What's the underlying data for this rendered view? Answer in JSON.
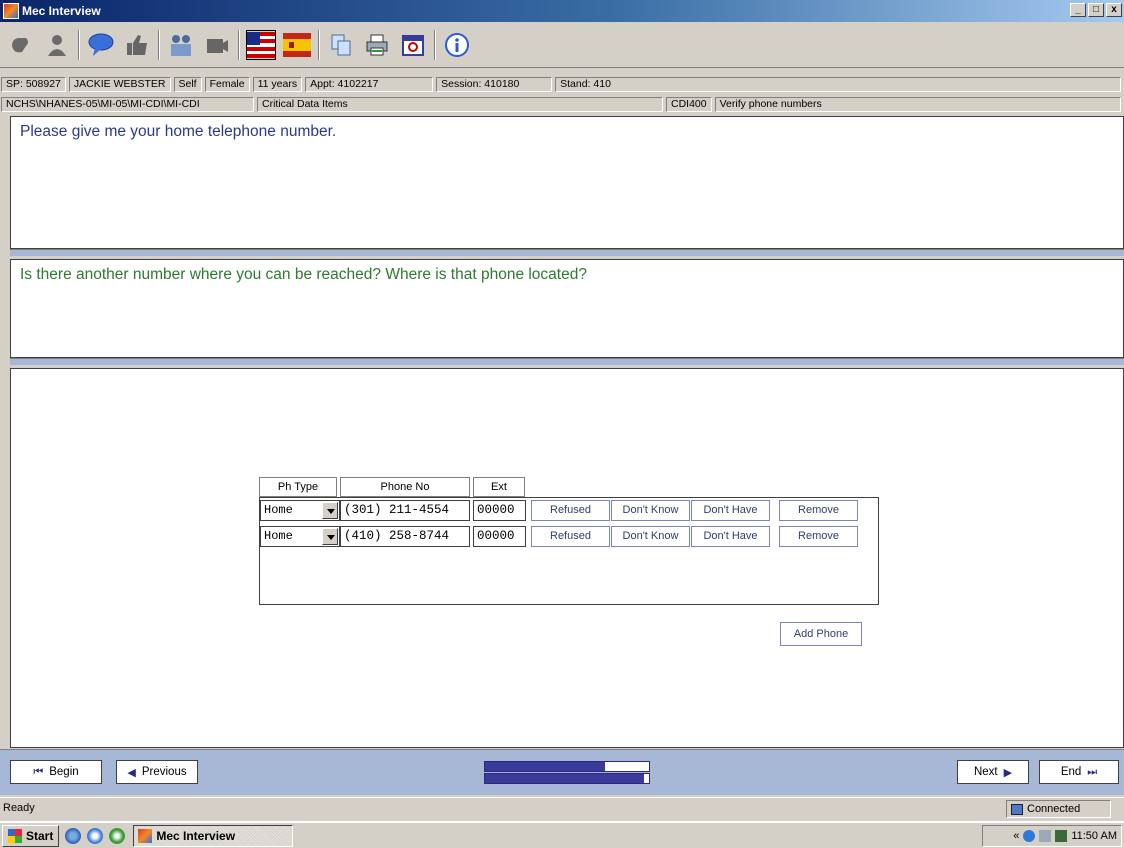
{
  "window": {
    "title": "Mec Interview",
    "controls": [
      "_",
      "□",
      "x"
    ]
  },
  "toolbar": {
    "icons": [
      "puzzle-icon",
      "person-icon",
      "speech-bubble-icon",
      "thumbs-up-icon",
      "people-icon",
      "video-icon",
      "us-flag-icon",
      "spain-flag-icon",
      "copy-icon",
      "printer-icon",
      "calendar-icon",
      "info-icon"
    ]
  },
  "info_bar_1": {
    "sp": "SP: 508927",
    "name": "JACKIE  WEBSTER",
    "relation": "Self",
    "gender": "Female",
    "age": "11 years",
    "appt": "Appt: 4102217",
    "session": "Session: 410180",
    "stand": "Stand: 410"
  },
  "info_bar_2": {
    "path": "NCHS\\NHANES-05\\MI-05\\MI-CDI\\MI-CDI",
    "section": "Critical Data Items",
    "code": "CDI400",
    "description": "Verify phone numbers"
  },
  "question_1": "Please give me your home telephone number.",
  "question_2": "Is there another number where you can be reached? Where is that phone located?",
  "phone_table": {
    "headers": {
      "type": "Ph Type",
      "number": "Phone No",
      "ext": "Ext"
    },
    "rows": [
      {
        "type": "Home",
        "number": "(301) 211-4554",
        "ext": "00000"
      },
      {
        "type": "Home",
        "number": "(410) 258-8744",
        "ext": "00000"
      }
    ],
    "row_buttons": {
      "refused": "Refused",
      "dont_know": "Don't Know",
      "dont_have": "Don't Have",
      "remove": "Remove"
    },
    "add_button": "Add Phone"
  },
  "navigation": {
    "begin": "Begin",
    "previous": "Previous",
    "next": "Next",
    "end": "End",
    "progress_top": 0.73,
    "progress_bottom": 0.97
  },
  "status": {
    "left": "Ready",
    "right": "Connected"
  },
  "taskbar": {
    "start": "start",
    "task": "Mec Interview",
    "time": "11:50 AM"
  },
  "colors": {
    "question_1": "#2a3a8a",
    "question_2": "#2e7a2e",
    "divider": "#a6b8d6"
  }
}
